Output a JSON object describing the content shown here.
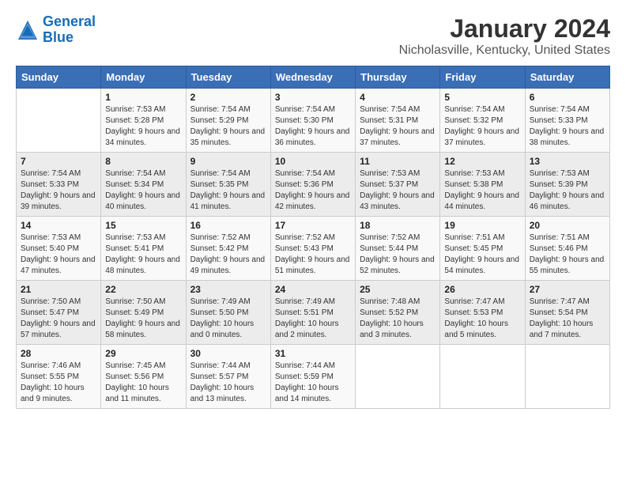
{
  "logo": {
    "text_general": "General",
    "text_blue": "Blue"
  },
  "title": "January 2024",
  "subtitle": "Nicholasville, Kentucky, United States",
  "headers": [
    "Sunday",
    "Monday",
    "Tuesday",
    "Wednesday",
    "Thursday",
    "Friday",
    "Saturday"
  ],
  "weeks": [
    [
      {
        "day": "",
        "sunrise": "",
        "sunset": "",
        "daylight": ""
      },
      {
        "day": "1",
        "sunrise": "Sunrise: 7:53 AM",
        "sunset": "Sunset: 5:28 PM",
        "daylight": "Daylight: 9 hours and 34 minutes."
      },
      {
        "day": "2",
        "sunrise": "Sunrise: 7:54 AM",
        "sunset": "Sunset: 5:29 PM",
        "daylight": "Daylight: 9 hours and 35 minutes."
      },
      {
        "day": "3",
        "sunrise": "Sunrise: 7:54 AM",
        "sunset": "Sunset: 5:30 PM",
        "daylight": "Daylight: 9 hours and 36 minutes."
      },
      {
        "day": "4",
        "sunrise": "Sunrise: 7:54 AM",
        "sunset": "Sunset: 5:31 PM",
        "daylight": "Daylight: 9 hours and 37 minutes."
      },
      {
        "day": "5",
        "sunrise": "Sunrise: 7:54 AM",
        "sunset": "Sunset: 5:32 PM",
        "daylight": "Daylight: 9 hours and 37 minutes."
      },
      {
        "day": "6",
        "sunrise": "Sunrise: 7:54 AM",
        "sunset": "Sunset: 5:33 PM",
        "daylight": "Daylight: 9 hours and 38 minutes."
      }
    ],
    [
      {
        "day": "7",
        "sunrise": "Sunrise: 7:54 AM",
        "sunset": "Sunset: 5:33 PM",
        "daylight": "Daylight: 9 hours and 39 minutes."
      },
      {
        "day": "8",
        "sunrise": "Sunrise: 7:54 AM",
        "sunset": "Sunset: 5:34 PM",
        "daylight": "Daylight: 9 hours and 40 minutes."
      },
      {
        "day": "9",
        "sunrise": "Sunrise: 7:54 AM",
        "sunset": "Sunset: 5:35 PM",
        "daylight": "Daylight: 9 hours and 41 minutes."
      },
      {
        "day": "10",
        "sunrise": "Sunrise: 7:54 AM",
        "sunset": "Sunset: 5:36 PM",
        "daylight": "Daylight: 9 hours and 42 minutes."
      },
      {
        "day": "11",
        "sunrise": "Sunrise: 7:53 AM",
        "sunset": "Sunset: 5:37 PM",
        "daylight": "Daylight: 9 hours and 43 minutes."
      },
      {
        "day": "12",
        "sunrise": "Sunrise: 7:53 AM",
        "sunset": "Sunset: 5:38 PM",
        "daylight": "Daylight: 9 hours and 44 minutes."
      },
      {
        "day": "13",
        "sunrise": "Sunrise: 7:53 AM",
        "sunset": "Sunset: 5:39 PM",
        "daylight": "Daylight: 9 hours and 46 minutes."
      }
    ],
    [
      {
        "day": "14",
        "sunrise": "Sunrise: 7:53 AM",
        "sunset": "Sunset: 5:40 PM",
        "daylight": "Daylight: 9 hours and 47 minutes."
      },
      {
        "day": "15",
        "sunrise": "Sunrise: 7:53 AM",
        "sunset": "Sunset: 5:41 PM",
        "daylight": "Daylight: 9 hours and 48 minutes."
      },
      {
        "day": "16",
        "sunrise": "Sunrise: 7:52 AM",
        "sunset": "Sunset: 5:42 PM",
        "daylight": "Daylight: 9 hours and 49 minutes."
      },
      {
        "day": "17",
        "sunrise": "Sunrise: 7:52 AM",
        "sunset": "Sunset: 5:43 PM",
        "daylight": "Daylight: 9 hours and 51 minutes."
      },
      {
        "day": "18",
        "sunrise": "Sunrise: 7:52 AM",
        "sunset": "Sunset: 5:44 PM",
        "daylight": "Daylight: 9 hours and 52 minutes."
      },
      {
        "day": "19",
        "sunrise": "Sunrise: 7:51 AM",
        "sunset": "Sunset: 5:45 PM",
        "daylight": "Daylight: 9 hours and 54 minutes."
      },
      {
        "day": "20",
        "sunrise": "Sunrise: 7:51 AM",
        "sunset": "Sunset: 5:46 PM",
        "daylight": "Daylight: 9 hours and 55 minutes."
      }
    ],
    [
      {
        "day": "21",
        "sunrise": "Sunrise: 7:50 AM",
        "sunset": "Sunset: 5:47 PM",
        "daylight": "Daylight: 9 hours and 57 minutes."
      },
      {
        "day": "22",
        "sunrise": "Sunrise: 7:50 AM",
        "sunset": "Sunset: 5:49 PM",
        "daylight": "Daylight: 9 hours and 58 minutes."
      },
      {
        "day": "23",
        "sunrise": "Sunrise: 7:49 AM",
        "sunset": "Sunset: 5:50 PM",
        "daylight": "Daylight: 10 hours and 0 minutes."
      },
      {
        "day": "24",
        "sunrise": "Sunrise: 7:49 AM",
        "sunset": "Sunset: 5:51 PM",
        "daylight": "Daylight: 10 hours and 2 minutes."
      },
      {
        "day": "25",
        "sunrise": "Sunrise: 7:48 AM",
        "sunset": "Sunset: 5:52 PM",
        "daylight": "Daylight: 10 hours and 3 minutes."
      },
      {
        "day": "26",
        "sunrise": "Sunrise: 7:47 AM",
        "sunset": "Sunset: 5:53 PM",
        "daylight": "Daylight: 10 hours and 5 minutes."
      },
      {
        "day": "27",
        "sunrise": "Sunrise: 7:47 AM",
        "sunset": "Sunset: 5:54 PM",
        "daylight": "Daylight: 10 hours and 7 minutes."
      }
    ],
    [
      {
        "day": "28",
        "sunrise": "Sunrise: 7:46 AM",
        "sunset": "Sunset: 5:55 PM",
        "daylight": "Daylight: 10 hours and 9 minutes."
      },
      {
        "day": "29",
        "sunrise": "Sunrise: 7:45 AM",
        "sunset": "Sunset: 5:56 PM",
        "daylight": "Daylight: 10 hours and 11 minutes."
      },
      {
        "day": "30",
        "sunrise": "Sunrise: 7:44 AM",
        "sunset": "Sunset: 5:57 PM",
        "daylight": "Daylight: 10 hours and 13 minutes."
      },
      {
        "day": "31",
        "sunrise": "Sunrise: 7:44 AM",
        "sunset": "Sunset: 5:59 PM",
        "daylight": "Daylight: 10 hours and 14 minutes."
      },
      {
        "day": "",
        "sunrise": "",
        "sunset": "",
        "daylight": ""
      },
      {
        "day": "",
        "sunrise": "",
        "sunset": "",
        "daylight": ""
      },
      {
        "day": "",
        "sunrise": "",
        "sunset": "",
        "daylight": ""
      }
    ]
  ]
}
